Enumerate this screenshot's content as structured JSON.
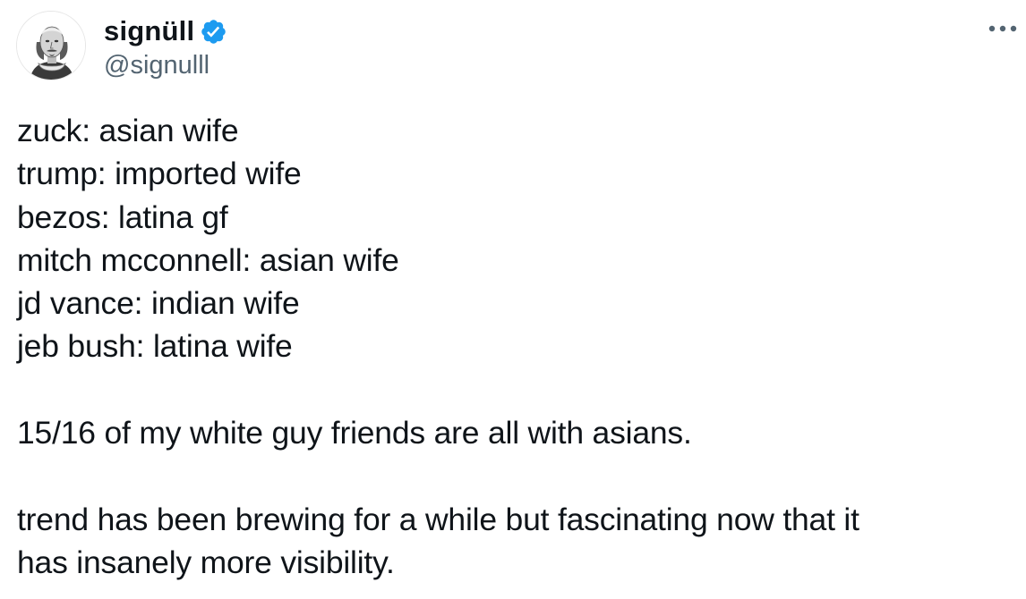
{
  "author": {
    "display_name": "signüll",
    "handle": "@signulll",
    "verified": true,
    "avatar_icon": "shakespeare-portrait-avatar"
  },
  "menu_icon": "more-options-icon",
  "colors": {
    "verified_blue": "#1d9bf0",
    "text_primary": "#0f1419",
    "text_secondary": "#536471"
  },
  "tweet": {
    "lines": [
      "zuck: asian wife",
      "trump: imported wife",
      "bezos: latina gf",
      "mitch mcconnell: asian wife",
      "jd vance: indian wife",
      "jeb bush: latina wife",
      "",
      "15/16 of my white guy friends are all with asians.",
      "",
      "trend has been brewing for a while but fascinating now that it",
      "has insanely more visibility."
    ]
  }
}
